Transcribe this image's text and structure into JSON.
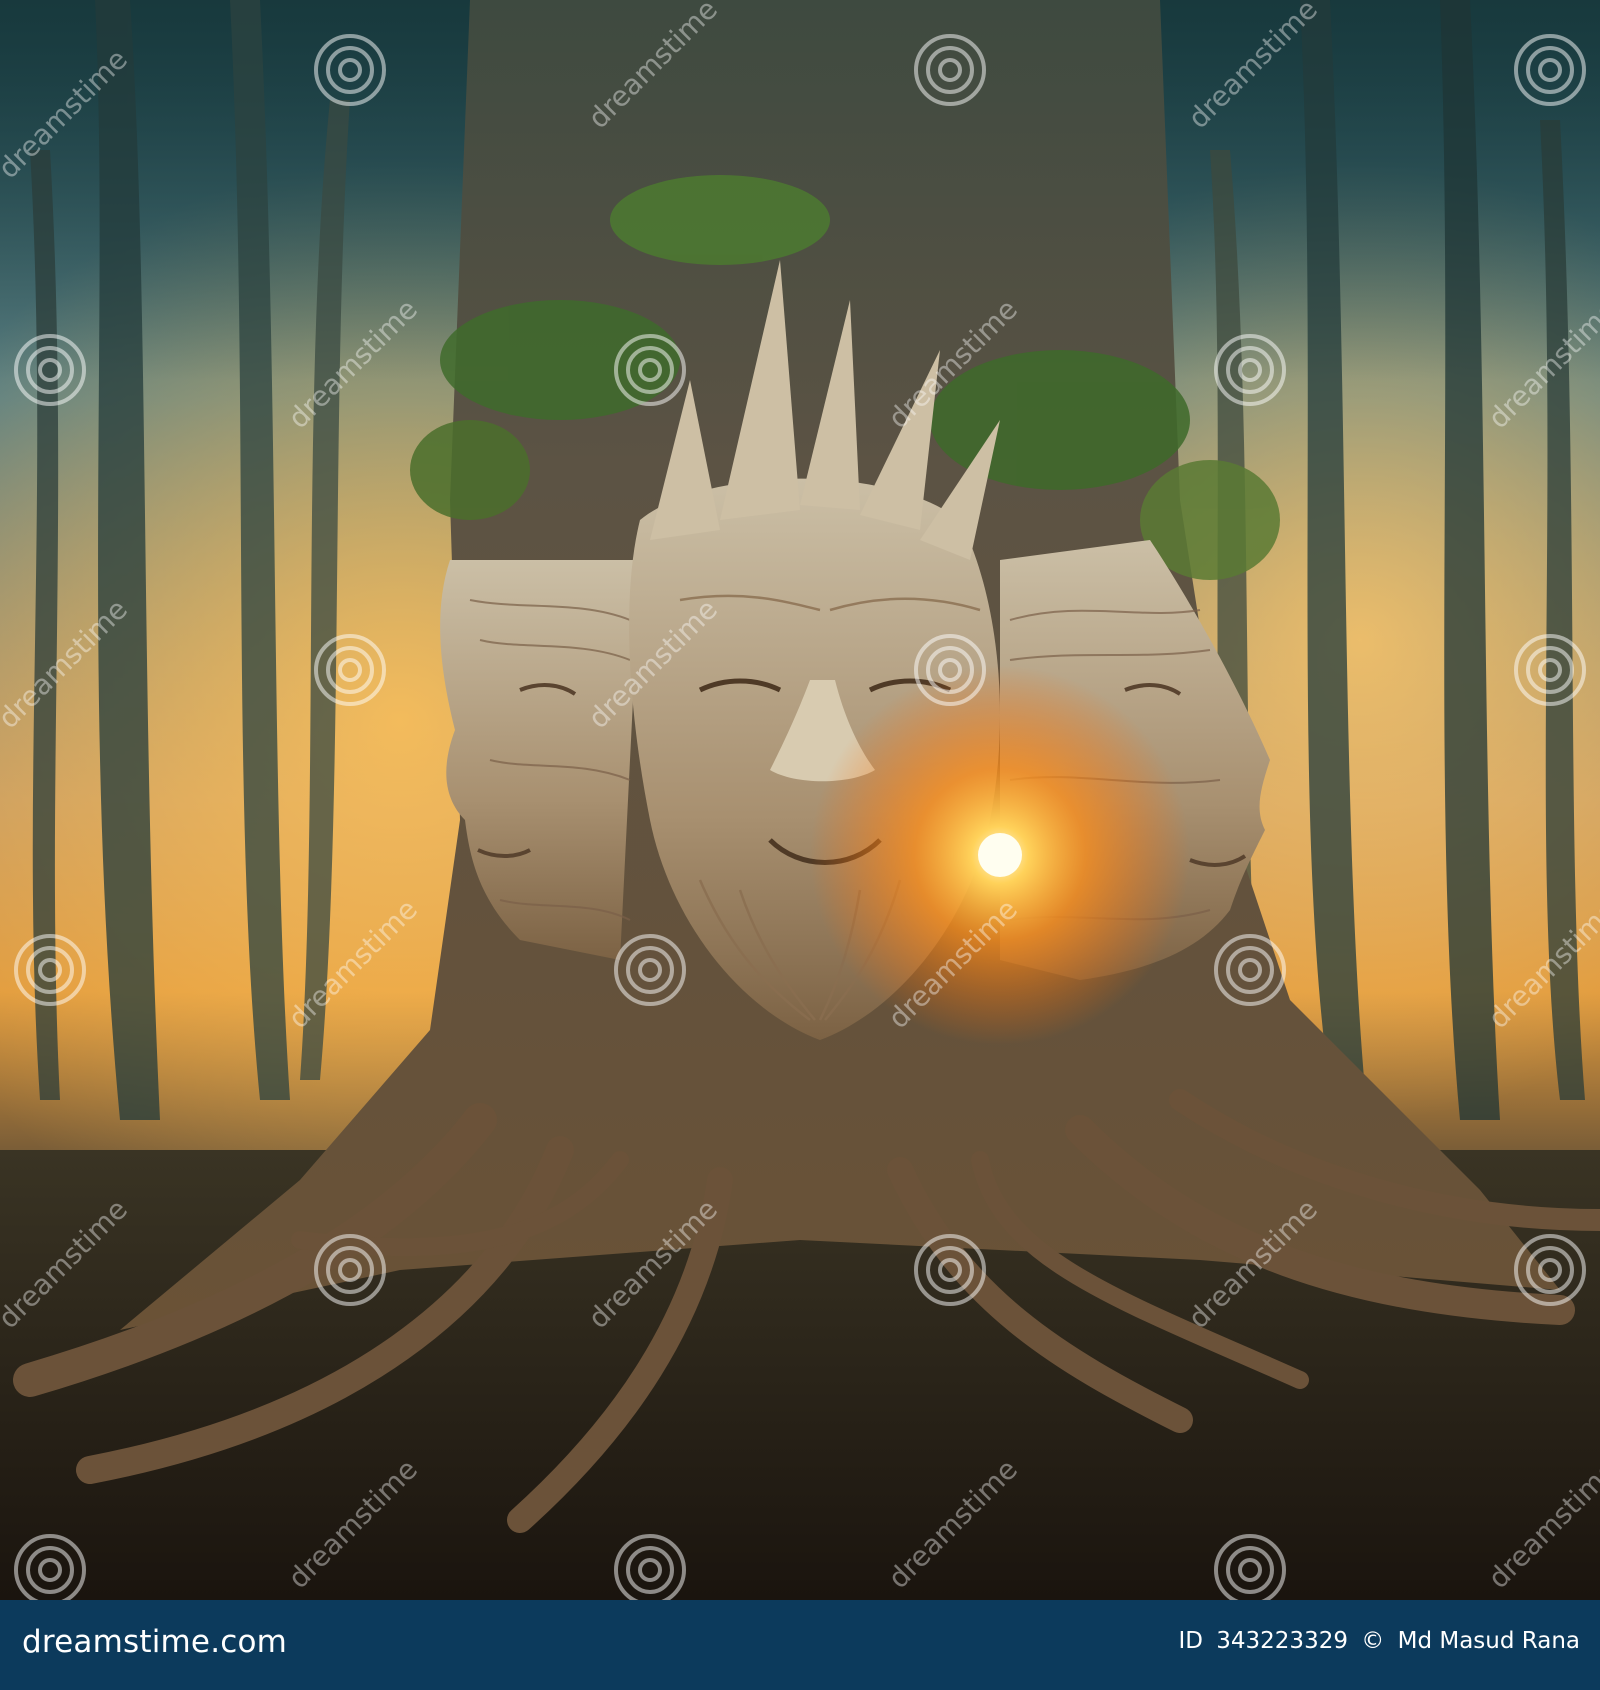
{
  "image": {
    "subject": "three-faced-tree-spirit",
    "watermark_text": "dreamstime",
    "watermark_icon": "spiral-logo-icon"
  },
  "footer": {
    "logo_text": "dreamstime.com",
    "id_label": "ID",
    "image_id": "343223329",
    "copyright_symbol": "©",
    "author": "Md Masud Rana",
    "background_color": "#0c3a5c"
  },
  "colors": {
    "sky_top": "#2e5a63",
    "sky_mid": "#8aa5a0",
    "glow": "#ffb23c",
    "sun_core": "#fff6c8",
    "trunk": "#8e7a62",
    "ground": "#2a2218"
  }
}
